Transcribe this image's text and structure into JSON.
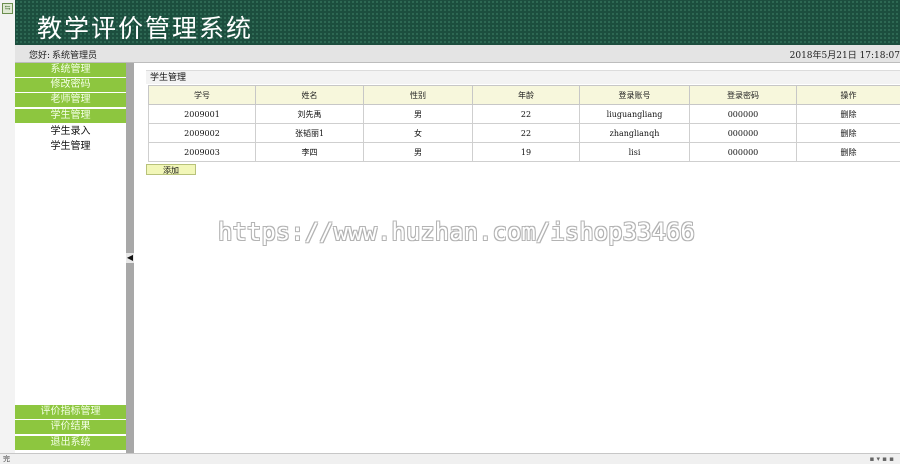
{
  "app": {
    "title": "教学评价管理系统",
    "greeting_label": "您好:",
    "greeting_role": "系统管理员",
    "datetime": "2018年5月21日  17:18:07"
  },
  "sidebar": {
    "top_items": [
      "系统管理",
      "修改密码",
      "老师管理",
      "学生管理"
    ],
    "sub_items": [
      "学生录入",
      "学生管理"
    ],
    "bottom_items": [
      "评价指标管理",
      "评价结果",
      "退出系统"
    ]
  },
  "panel": {
    "title": "学生管理",
    "columns": [
      "学号",
      "姓名",
      "性别",
      "年龄",
      "登录账号",
      "登录密码",
      "操作"
    ],
    "rows": [
      [
        "2009001",
        "刘先禹",
        "男",
        "22",
        "liuguangliang",
        "000000",
        "删除"
      ],
      [
        "2009002",
        "张韬丽1",
        "女",
        "22",
        "zhanglianqh",
        "000000",
        "删除"
      ],
      [
        "2009003",
        "李四",
        "男",
        "19",
        "lisi",
        "000000",
        "删除"
      ]
    ],
    "add_label": "添加"
  },
  "watermark": "https://www.huzhan.com/ishop33466",
  "statusbar": {
    "left": "完"
  },
  "colors": {
    "banner": "#1c4e3e",
    "menu": "#8dc63f",
    "header_row": "#f7f7dc",
    "add_button": "#f2f7b8"
  }
}
